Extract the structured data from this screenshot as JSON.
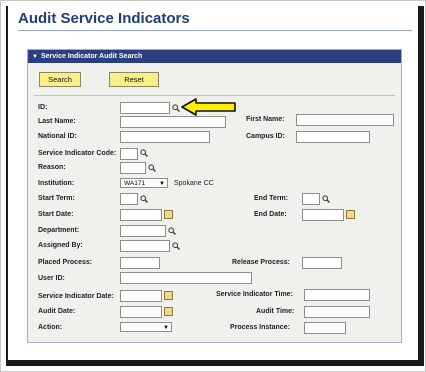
{
  "page": {
    "title": "Audit Service Indicators"
  },
  "panel": {
    "title": "Service Indicator Audit Search"
  },
  "buttons": {
    "search": "Search",
    "reset": "Reset"
  },
  "fields": {
    "id": "ID:",
    "last_name": "Last Name:",
    "first_name": "First Name:",
    "national_id": "National ID:",
    "campus_id": "Campus ID:",
    "service_indicator_code": "Service Indicator Code:",
    "reason": "Reason:",
    "institution": "Institution:",
    "start_term": "Start Term:",
    "end_term": "End Term:",
    "start_date": "Start Date:",
    "end_date": "End Date:",
    "department": "Department:",
    "assigned_by": "Assigned By:",
    "placed_process": "Placed Process:",
    "release_process": "Release Process:",
    "user_id": "User ID:",
    "service_indicator_date": "Service Indicator Date:",
    "service_indicator_time": "Service Indicator Time:",
    "audit_date": "Audit Date:",
    "audit_time": "Audit Time:",
    "action": "Action:",
    "process_instance": "Process Instance:"
  },
  "values": {
    "institution": "WA171",
    "institution_name": "Spokane CC"
  },
  "colors": {
    "panel_header": "#2c3f80",
    "button": "#f6ef88",
    "title": "#1f3d7a",
    "pointer": "#ffee00"
  },
  "icons": {
    "lookup": "magnifier-icon",
    "calendar": "calendar-icon",
    "pointer": "yellow-arrow-pointer"
  }
}
